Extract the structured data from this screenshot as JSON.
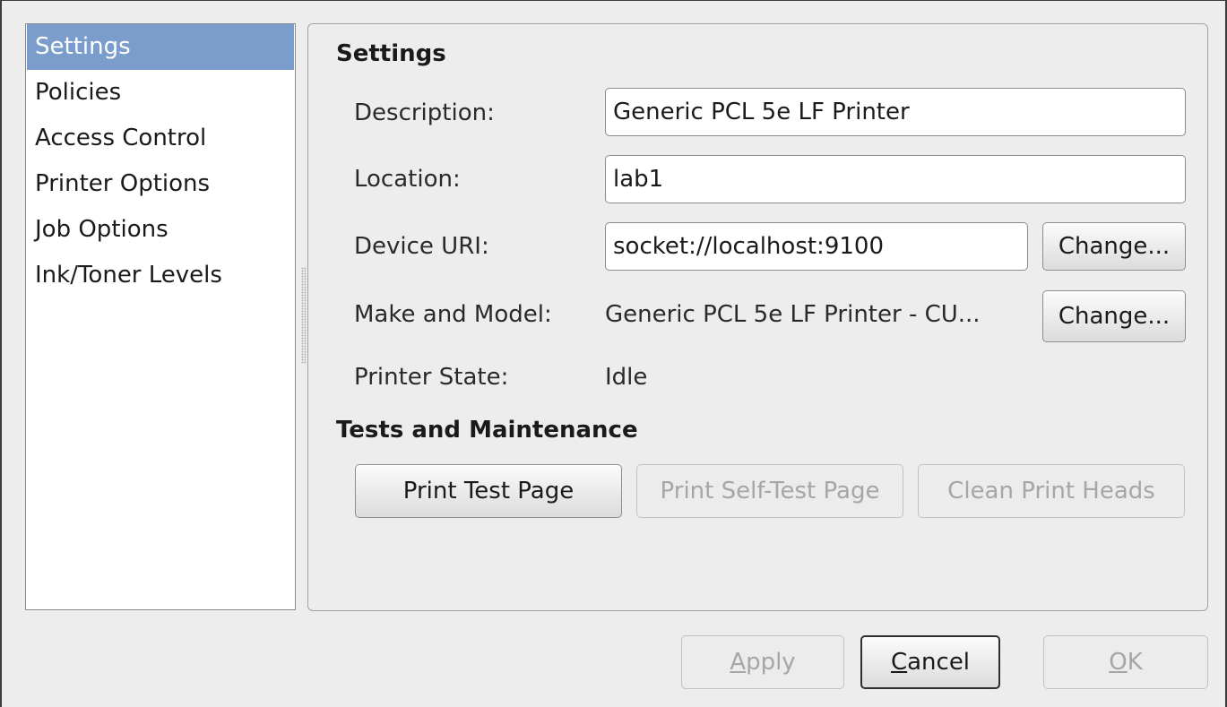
{
  "sidebar": {
    "items": [
      {
        "label": "Settings",
        "selected": true
      },
      {
        "label": "Policies",
        "selected": false
      },
      {
        "label": "Access Control",
        "selected": false
      },
      {
        "label": "Printer Options",
        "selected": false
      },
      {
        "label": "Job Options",
        "selected": false
      },
      {
        "label": "Ink/Toner Levels",
        "selected": false
      }
    ]
  },
  "settings": {
    "heading": "Settings",
    "description_label": "Description:",
    "description_value": "Generic PCL 5e LF Printer",
    "location_label": "Location:",
    "location_value": "lab1",
    "device_uri_label": "Device URI:",
    "device_uri_value": "socket://localhost:9100",
    "device_uri_change_label": "Change...",
    "make_model_label": "Make and Model:",
    "make_model_value": "Generic PCL 5e LF Printer - CU...",
    "make_model_change_label": "Change...",
    "printer_state_label": "Printer State:",
    "printer_state_value": "Idle"
  },
  "tests": {
    "heading": "Tests and Maintenance",
    "print_test_page": "Print Test Page",
    "print_self_test_page": "Print Self-Test Page",
    "clean_print_heads": "Clean Print Heads"
  },
  "dialog_buttons": {
    "apply": {
      "mnemonic": "A",
      "rest": "pply"
    },
    "cancel": {
      "mnemonic": "C",
      "rest": "ancel"
    },
    "ok": {
      "mnemonic": "O",
      "rest": "K"
    }
  },
  "colors": {
    "selection": "#7b9dcb",
    "window_bg": "#ededed"
  }
}
